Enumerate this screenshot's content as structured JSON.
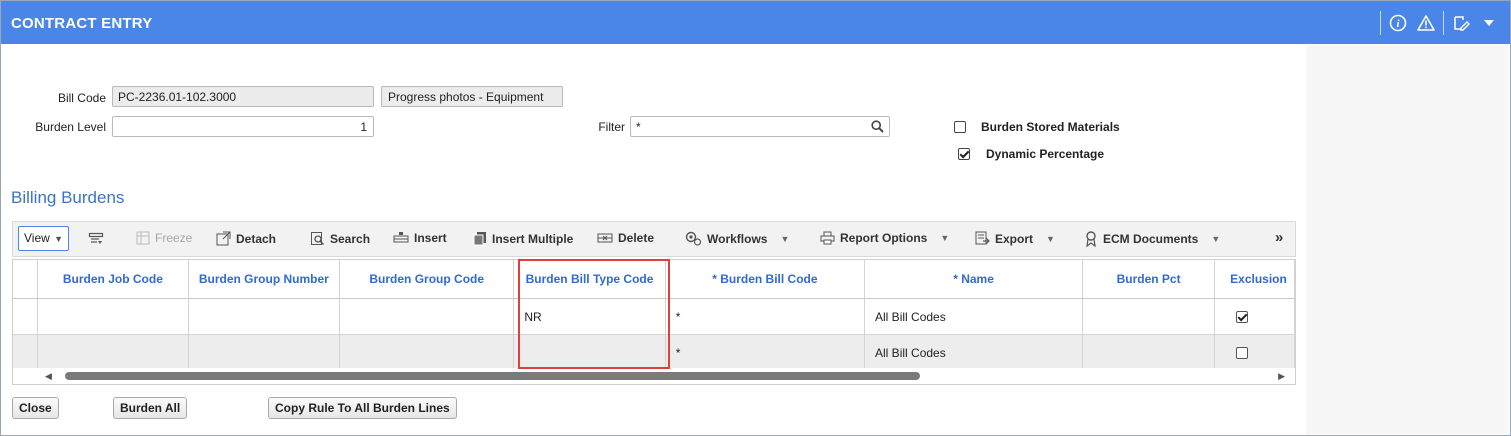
{
  "window": {
    "title": "CONTRACT ENTRY",
    "icons": [
      "info-icon",
      "warning-icon",
      "edit-icon",
      "menu-caret-icon"
    ]
  },
  "form": {
    "bill_code_label": "Bill Code",
    "bill_code_value": "PC-2236.01-102.3000",
    "bill_code_desc": "Progress photos - Equipment",
    "burden_level_label": "Burden Level",
    "burden_level_value": "1",
    "filter_label": "Filter",
    "filter_value": "*",
    "burden_stored_materials_label": "Burden Stored Materials",
    "burden_stored_materials_checked": false,
    "dynamic_percentage_label": "Dynamic Percentage",
    "dynamic_percentage_checked": true
  },
  "section": {
    "title": "Billing Burdens"
  },
  "toolbar": {
    "view_label": "View",
    "freeze_label": "Freeze",
    "detach_label": "Detach",
    "search_label": "Search",
    "insert_label": "Insert",
    "insert_multiple_label": "Insert Multiple",
    "delete_label": "Delete",
    "workflows_label": "Workflows",
    "report_options_label": "Report Options",
    "export_label": "Export",
    "ecm_documents_label": "ECM Documents",
    "more_label": "»"
  },
  "grid": {
    "columns": [
      "Burden Job Code",
      "Burden Group Number",
      "Burden Group Code",
      "Burden Bill Type Code",
      "* Burden Bill Code",
      "* Name",
      "Burden Pct",
      "Exclusion"
    ],
    "rows": [
      {
        "job_code": "",
        "group_number": "",
        "group_code": "",
        "bill_type_code": "NR",
        "bill_code": "*",
        "name": "All Bill Codes",
        "pct": "",
        "exclusion": true
      },
      {
        "job_code": "",
        "group_number": "",
        "group_code": "",
        "bill_type_code": "",
        "bill_code": "*",
        "name": "All Bill Codes",
        "pct": "",
        "exclusion": false
      }
    ]
  },
  "footer": {
    "close_label": "Close",
    "burden_all_label": "Burden All",
    "copy_rule_label": "Copy Rule To All Burden Lines"
  },
  "colors": {
    "titlebar": "#4a86e8",
    "header_text": "#2f6bd0",
    "highlight": "#e0403a"
  }
}
